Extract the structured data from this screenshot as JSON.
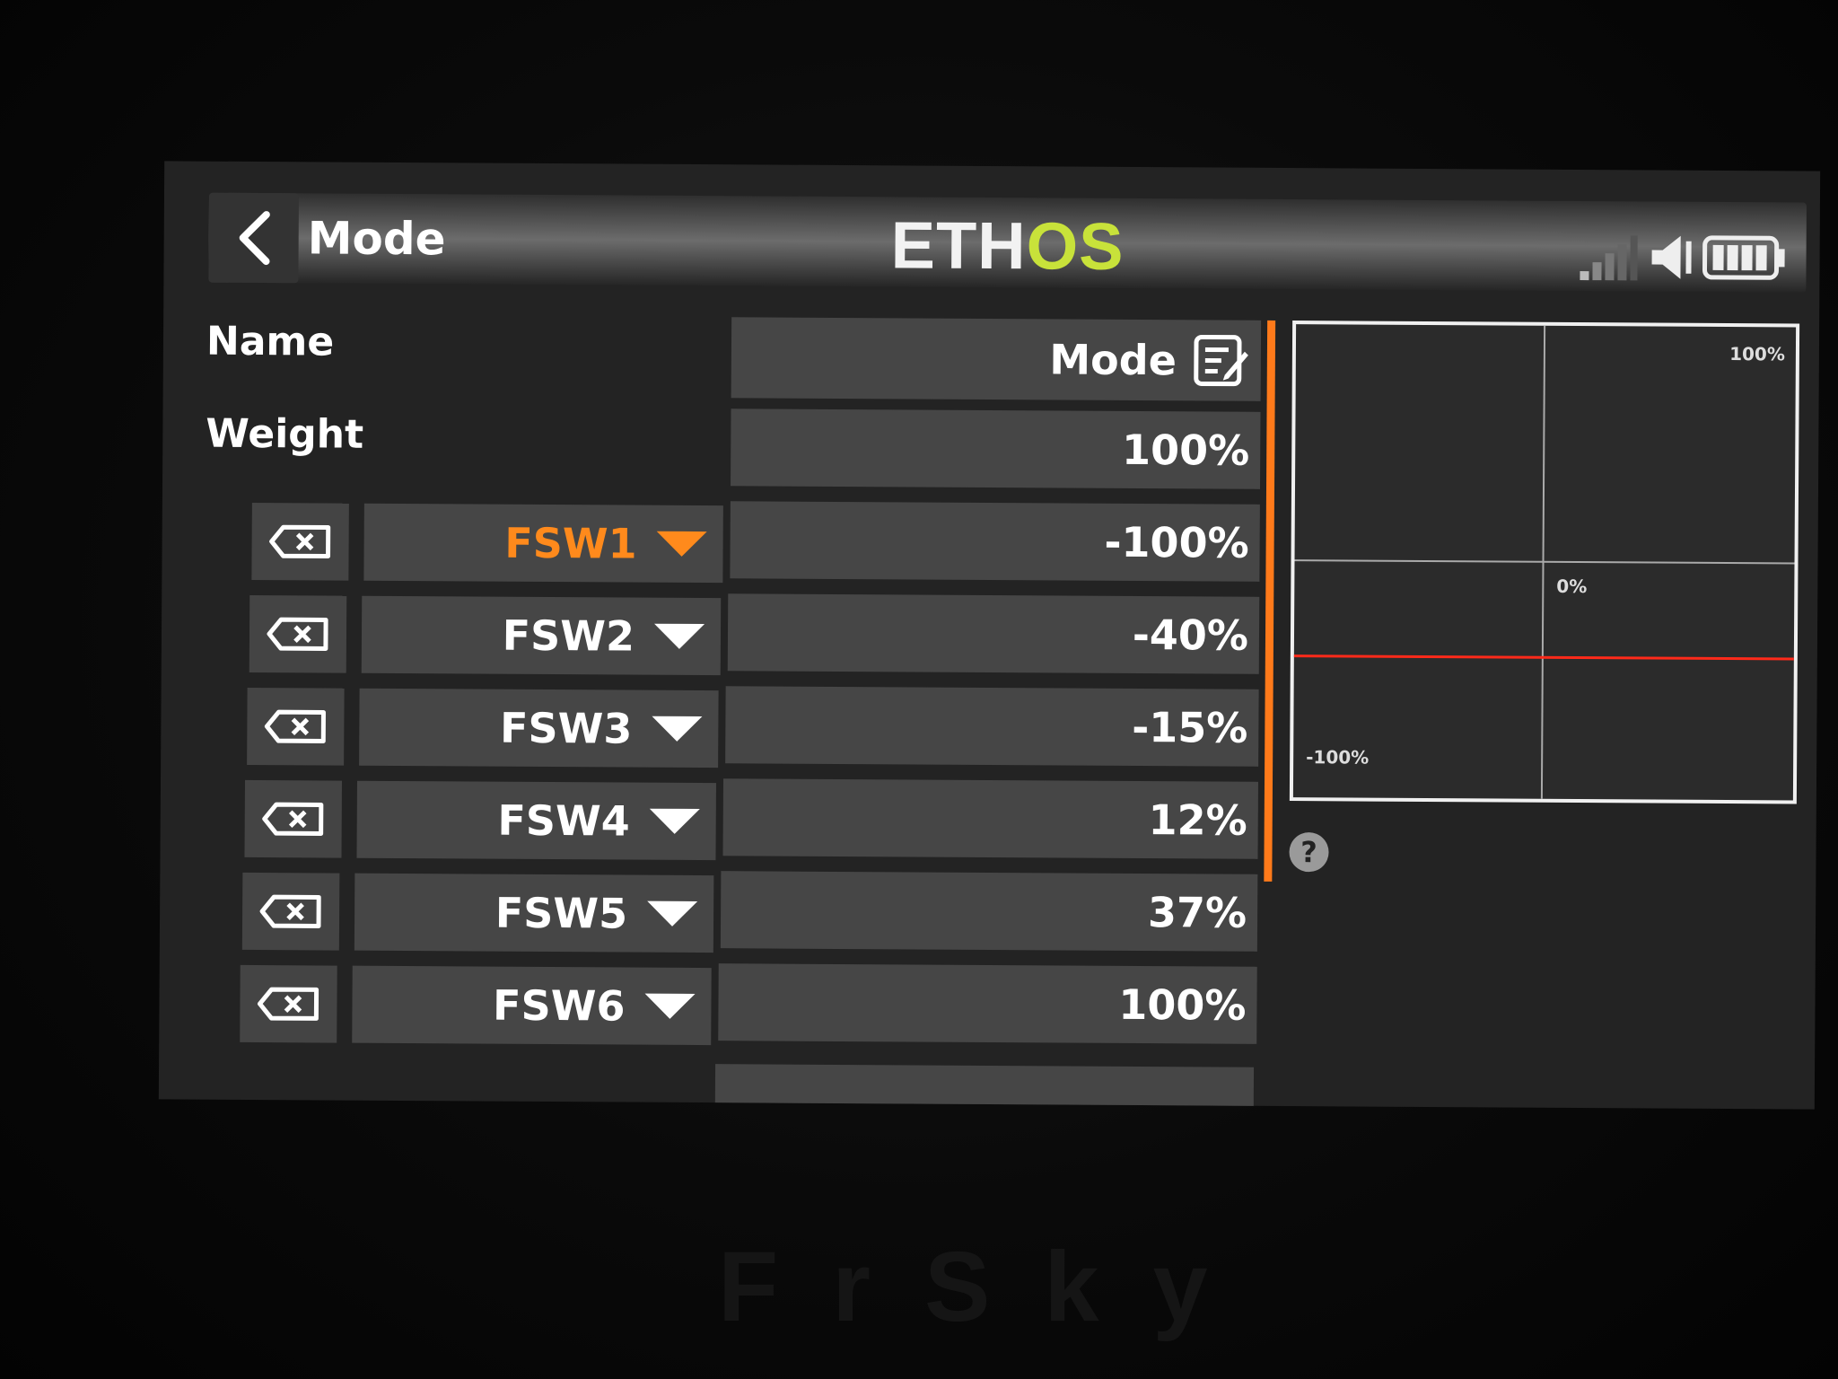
{
  "header": {
    "back_icon": "chevron-left-icon",
    "title": "Mode",
    "logo_primary": "ETH",
    "logo_accent": "OS",
    "status_icons": [
      "signal-bars-icon",
      "speaker-icon",
      "battery-icon"
    ],
    "accent_color": "#c8e23a"
  },
  "form": {
    "name_label": "Name",
    "name_value": "Mode",
    "name_edit_icon": "edit-icon",
    "weight_label": "Weight",
    "weight_value": "100%"
  },
  "rows": [
    {
      "switch": "FSW1",
      "value": "-100%",
      "active": true
    },
    {
      "switch": "FSW2",
      "value": "-40%",
      "active": false
    },
    {
      "switch": "FSW3",
      "value": "-15%",
      "active": false
    },
    {
      "switch": "FSW4",
      "value": "12%",
      "active": false
    },
    {
      "switch": "FSW5",
      "value": "37%",
      "active": false
    },
    {
      "switch": "FSW6",
      "value": "100%",
      "active": false
    }
  ],
  "active_color": "#ff8a1c",
  "curve": {
    "top_label": "100%",
    "center_label": "0%",
    "bottom_label": "-100%",
    "output_line_color": "#ff2a1a"
  },
  "help_label": "?",
  "brand": "FrSky"
}
